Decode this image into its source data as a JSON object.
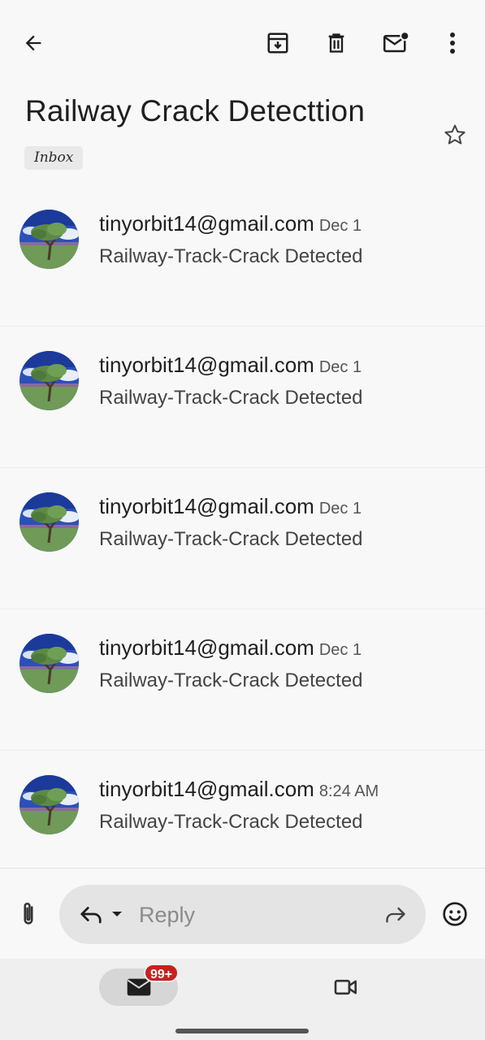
{
  "header": {
    "back_icon": "arrow-left-icon",
    "actions": [
      {
        "name": "archive-button",
        "icon": "archive-icon"
      },
      {
        "name": "delete-button",
        "icon": "trash-icon"
      },
      {
        "name": "mark-unread-button",
        "icon": "mail-unread-icon"
      },
      {
        "name": "more-options-button",
        "icon": "more-vert-icon"
      }
    ]
  },
  "thread": {
    "title": "Railway Crack Detecttion",
    "label": "Inbox",
    "starred": false
  },
  "messages": [
    {
      "sender": "tinyorbit14@gmail.com",
      "date": "Dec 1",
      "subject": "Railway-Track-Crack Detected"
    },
    {
      "sender": "tinyorbit14@gmail.com",
      "date": "Dec 1",
      "subject": "Railway-Track-Crack Detected"
    },
    {
      "sender": "tinyorbit14@gmail.com",
      "date": "Dec 1",
      "subject": "Railway-Track-Crack Detected"
    },
    {
      "sender": "tinyorbit14@gmail.com",
      "date": "Dec 1",
      "subject": "Railway-Track-Crack Detected"
    },
    {
      "sender": "tinyorbit14@gmail.com",
      "date": "8:24 AM",
      "subject": "Railway-Track-Crack Detected"
    }
  ],
  "reply": {
    "placeholder": "Reply"
  },
  "bottom_nav": {
    "mail_badge": "99+"
  },
  "colors": {
    "badge": "#c5221f",
    "background": "#f8f8f8",
    "pill": "#e4e4e4"
  }
}
